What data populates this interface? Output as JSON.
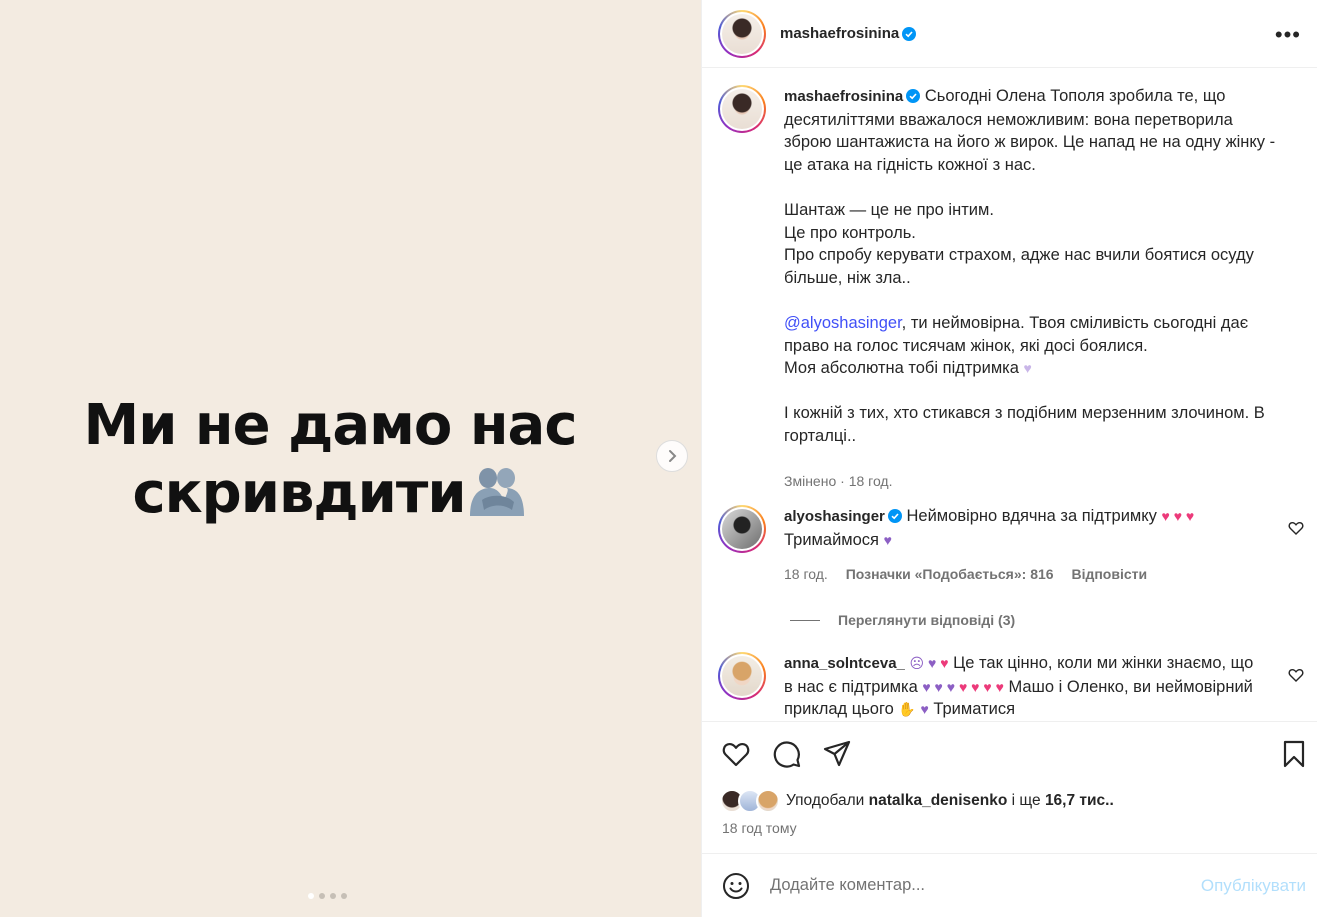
{
  "media": {
    "line1": "Ми не дамо нас",
    "line2": "скривдити",
    "dots_total": 4,
    "dots_active": 1
  },
  "header": {
    "username": "mashaefrosinina",
    "verified": true
  },
  "caption": {
    "username": "mashaefrosinina",
    "p1": "Сьогодні Олена Тополя зробила те, що десятиліттями вважалося неможливим: вона перетворила зброю шантажиста на його ж вирок. Це напад не на одну жінку - це атака на гідність кожної з нас.",
    "p2_l1": "Шантаж — це не про інтим.",
    "p2_l2": "Це про контроль.",
    "p2_l3": "Про спробу керувати страхом, адже нас вчили боятися осуду більше, ніж зла..",
    "p3_mention": "@alyoshasinger",
    "p3_rest": ", ти неймовірна. Твоя сміливість сьогодні дає право на голос тисячам жінок, які досі боялися.",
    "p3_l2": "Моя абсолютна тобі підтримка",
    "p4": "І кожній з тих, хто стикався з подібним мерзенним злочином. В горталці..",
    "edited": "Змінено",
    "time": "18 год."
  },
  "comments": [
    {
      "username": "alyoshasinger",
      "verified": true,
      "text": "Неймовірно вдячна за підтримку",
      "text2": "Тримаймося",
      "time": "18 год.",
      "likes": "Позначки «Подобається»: 816",
      "reply": "Відповісти"
    },
    {
      "username": "anna_solntceva_",
      "text_a": "Це так цінно, коли ми жінки знаємо, що в нас є підтримка",
      "text_b": "Машо і Оленко, ви неймовірний приклад цього",
      "text_c": "Триматися"
    }
  ],
  "view_replies": "Переглянути відповіді (3)",
  "likes": {
    "prefix": "Уподобали",
    "user": "natalka_denisenko",
    "middle": "і ще",
    "count": "16,7 тис."
  },
  "time_ago": "18 год тому",
  "comment_bar": {
    "placeholder": "Додайте коментар...",
    "post_label": "Опублікувати"
  }
}
